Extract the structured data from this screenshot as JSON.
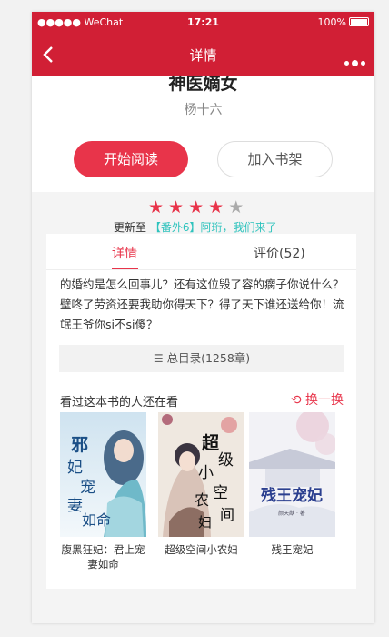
{
  "status": {
    "carrier": "●●●●● WeChat",
    "wifi": "wifi-icon",
    "time": "17:21",
    "battery": "100%"
  },
  "nav": {
    "title": "详情"
  },
  "book": {
    "title": "神医嫡女",
    "author": "杨十六"
  },
  "buttons": {
    "read": "开始阅读",
    "shelf": "加入书架"
  },
  "rating": {
    "value": 4,
    "max": 5
  },
  "update": {
    "prefix": "更新至",
    "chapter": "【番外6】阿珩，我们来了"
  },
  "tabs": [
    {
      "label": "详情"
    },
    {
      "label": "评价(52)"
    }
  ],
  "synopsis": "的婚约是怎么回事儿？还有这位毁了容的瘸子你说什么？壁咚了劳资还要我助你得天下？得了天下谁还送给你！流氓王爷你si不si傻？",
  "toc": {
    "label": "总目录(1258章)"
  },
  "also": {
    "title": "看过这本书的人还在看",
    "refresh": "换一换"
  },
  "books": [
    {
      "name": "腹黑狂妃：君上宠妻如命",
      "cover_text": "邪妃宠妻如命"
    },
    {
      "name": "超级空间小农妇",
      "cover_text": "超级空间小农妇"
    },
    {
      "name": "残王宠妃",
      "cover_text": "残王宠妃",
      "cover_author": "颜天猷 · 著"
    }
  ],
  "colors": {
    "brand": "#d11f35",
    "accent": "#e8344a",
    "link": "#2ec3bd"
  }
}
